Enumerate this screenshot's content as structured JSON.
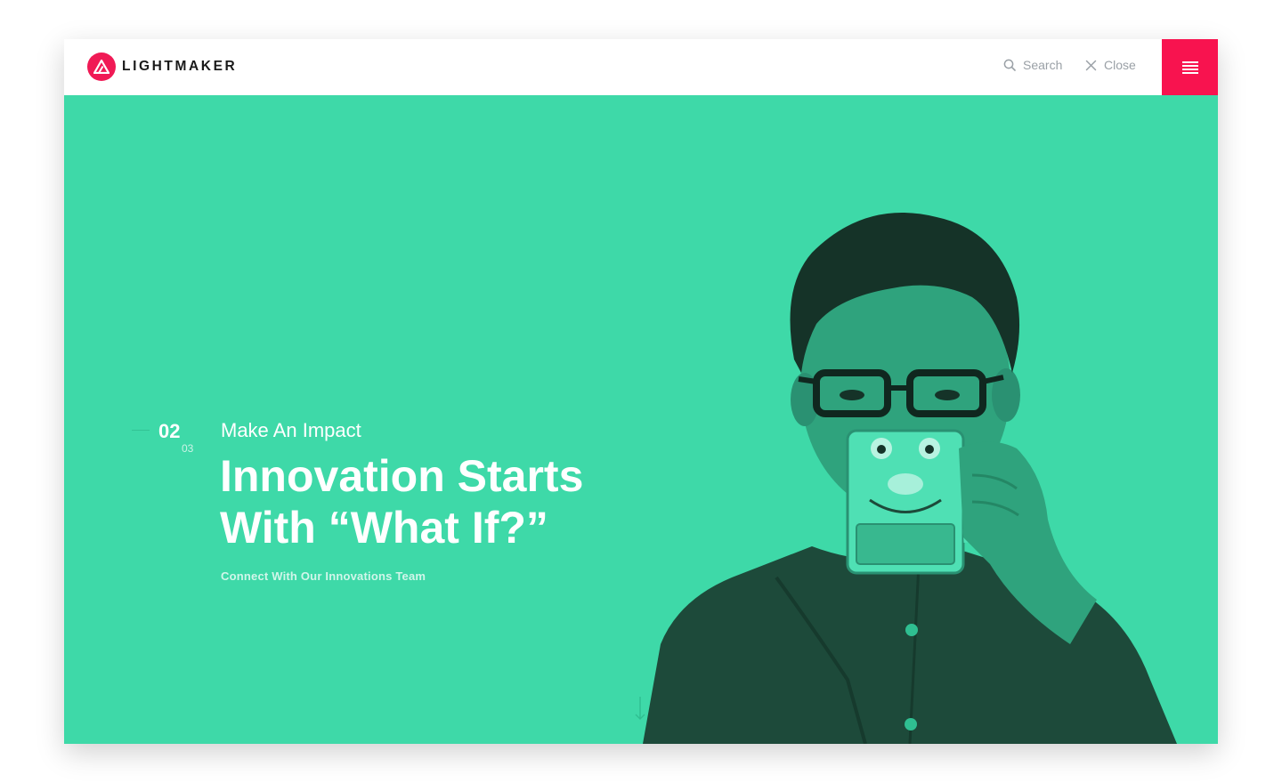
{
  "header": {
    "logo_text": "LIGHTMAKER",
    "search_label": "Search",
    "close_label": "Close"
  },
  "hero": {
    "counter_current": "02",
    "counter_total": "03",
    "eyebrow": "Make An Impact",
    "headline_line1": "Innovation Starts",
    "headline_line2": "With “What If?”",
    "cta_label": "Connect With Our Innovations Team"
  },
  "colors": {
    "accent": "#f8134f",
    "hero_background": "#3ed9a8",
    "header_background": "#ffffff",
    "nav_text": "#9aa0a6"
  },
  "icons": {
    "logo": "triangle-logo-icon",
    "search": "search-icon",
    "close": "close-icon",
    "menu": "hamburger-menu-icon",
    "scroll": "arrow-down-icon"
  }
}
